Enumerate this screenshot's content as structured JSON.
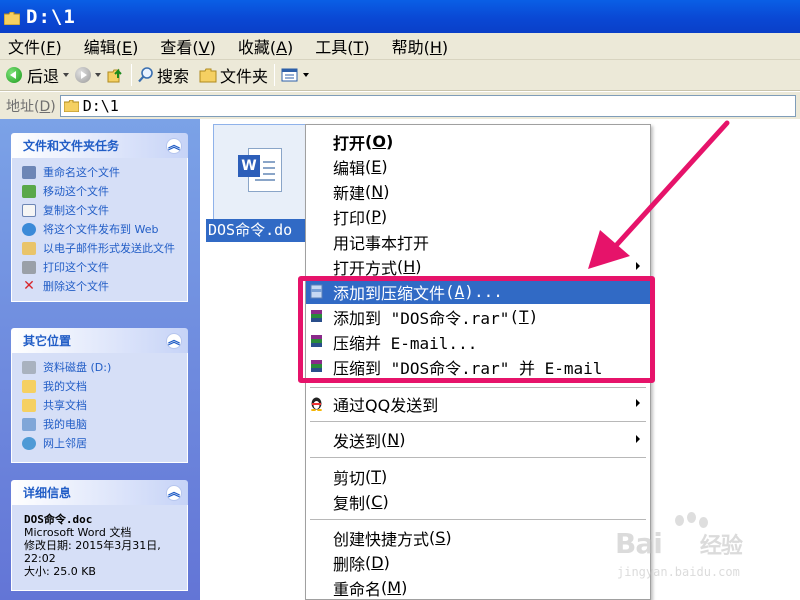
{
  "window": {
    "title": "D:\\1"
  },
  "menubar": [
    {
      "label": "文件",
      "key": "F"
    },
    {
      "label": "编辑",
      "key": "E"
    },
    {
      "label": "查看",
      "key": "V"
    },
    {
      "label": "收藏",
      "key": "A"
    },
    {
      "label": "工具",
      "key": "T"
    },
    {
      "label": "帮助",
      "key": "H"
    }
  ],
  "toolbar": {
    "back": "后退",
    "search": "搜索",
    "folders": "文件夹"
  },
  "address": {
    "label": "地址",
    "key": "D",
    "path": "D:\\1"
  },
  "tasks": {
    "file_tasks": {
      "title": "文件和文件夹任务",
      "items": [
        "重命名这个文件",
        "移动这个文件",
        "复制这个文件",
        "将这个文件发布到 Web",
        "以电子邮件形式发送此文件",
        "打印这个文件",
        "删除这个文件"
      ]
    },
    "other_places": {
      "title": "其它位置",
      "items": [
        "资料磁盘 (D:)",
        "我的文档",
        "共享文档",
        "我的电脑",
        "网上邻居"
      ]
    },
    "details": {
      "title": "详细信息",
      "name": "DOS命令.doc",
      "type": "Microsoft Word 文档",
      "modified_label": "修改日期: 2015年3月31日,",
      "modified_time": "22:02",
      "size": "大小: 25.0 KB"
    }
  },
  "file": {
    "name": "DOS命令.doc",
    "display": "DOS命令.do",
    "badge": "W"
  },
  "context_menu": {
    "items": [
      {
        "label": "打开",
        "key": "O"
      },
      {
        "label": "编辑",
        "key": "E"
      },
      {
        "label": "新建",
        "key": "N"
      },
      {
        "label": "打印",
        "key": "P"
      },
      {
        "label": "用记事本打开"
      },
      {
        "label": "打开方式",
        "key": "H"
      },
      {
        "label": "添加到压缩文件",
        "key": "A",
        "suffix": "..."
      },
      {
        "label": "添加到 \"DOS命令.rar\"",
        "key": "T"
      },
      {
        "label": "压缩并 E-mail..."
      },
      {
        "label": "压缩到 \"DOS命令.rar\" 并 E-mail"
      },
      {
        "label": "通过QQ发送到"
      },
      {
        "label": "发送到",
        "key": "N"
      },
      {
        "label": "剪切",
        "key": "T"
      },
      {
        "label": "复制",
        "key": "C"
      },
      {
        "label": "创建快捷方式",
        "key": "S"
      },
      {
        "label": "删除",
        "key": "D"
      },
      {
        "label": "重命名",
        "key": "M"
      }
    ]
  },
  "watermark": {
    "brand": "Bai",
    "brand2": "经验",
    "url": "jingyan.baidu.com"
  },
  "colors": {
    "accent": "#e6136a",
    "selection": "#316ac5",
    "titlebar": "#0a48d4"
  }
}
